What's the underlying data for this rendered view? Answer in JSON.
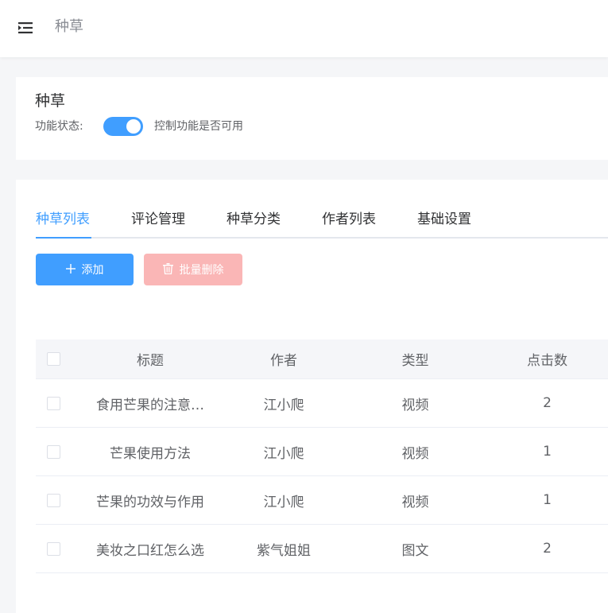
{
  "header": {
    "breadcrumb": "种草"
  },
  "status_card": {
    "title": "种草",
    "label": "功能状态:",
    "enabled": true,
    "hint": "控制功能是否可用"
  },
  "tabs": [
    {
      "label": "种草列表",
      "active": true
    },
    {
      "label": "评论管理",
      "active": false
    },
    {
      "label": "种草分类",
      "active": false
    },
    {
      "label": "作者列表",
      "active": false
    },
    {
      "label": "基础设置",
      "active": false
    }
  ],
  "toolbar": {
    "add_label": "添加",
    "batch_delete_label": "批量删除"
  },
  "table": {
    "columns": [
      "标题",
      "作者",
      "类型",
      "点击数"
    ],
    "rows": [
      {
        "title": "食用芒果的注意…",
        "author": "江小爬",
        "type": "视频",
        "clicks": "2"
      },
      {
        "title": "芒果使用方法",
        "author": "江小爬",
        "type": "视频",
        "clicks": "1"
      },
      {
        "title": "芒果的功效与作用",
        "author": "江小爬",
        "type": "视频",
        "clicks": "1"
      },
      {
        "title": "美妆之口红怎么选",
        "author": "紫气姐姐",
        "type": "图文",
        "clicks": "2"
      }
    ]
  },
  "colors": {
    "primary": "#409eff",
    "danger_disabled": "#fab6b6"
  },
  "icons": {
    "menu": "menu-fold-icon",
    "add": "plus-icon",
    "delete": "trash-icon"
  }
}
